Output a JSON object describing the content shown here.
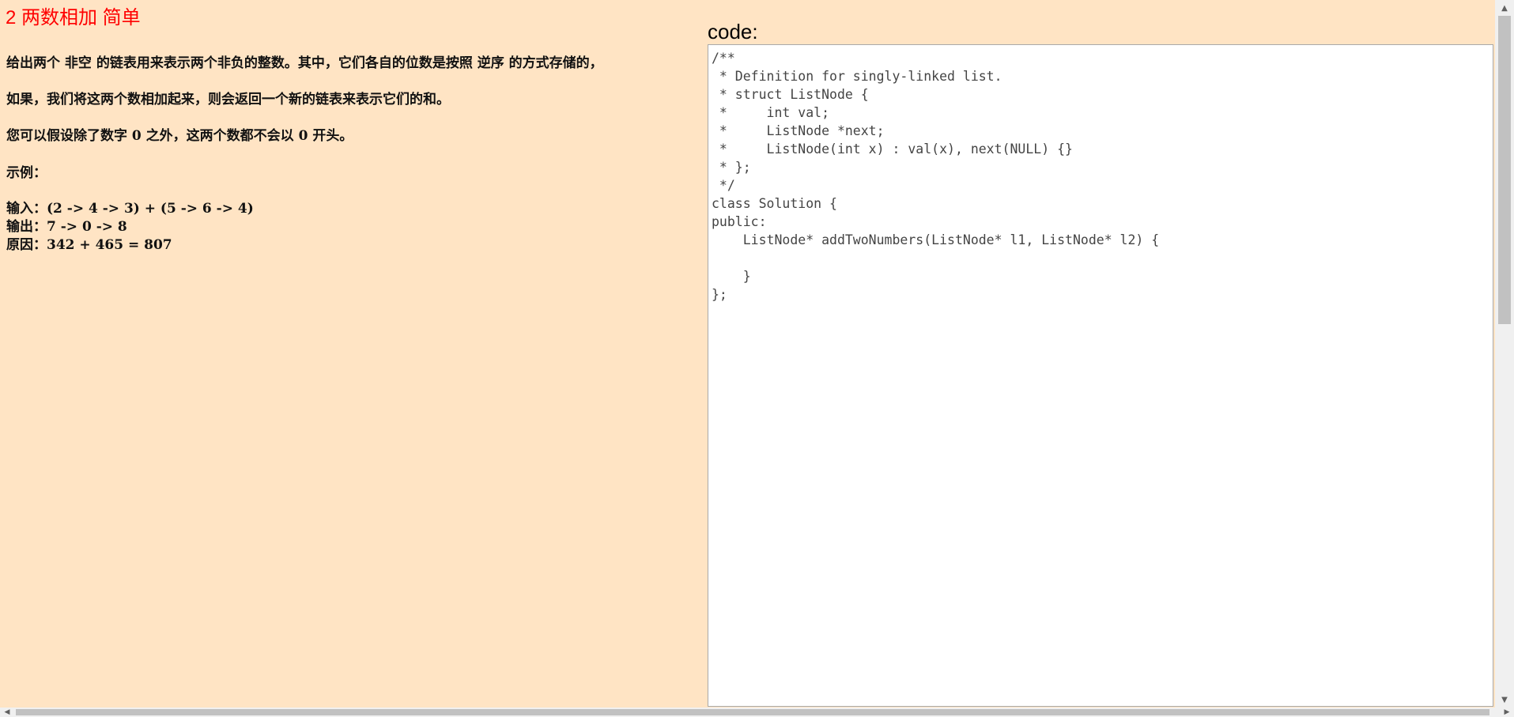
{
  "problem": {
    "title": "2 两数相加 简单",
    "paragraphs": [
      "给出两个 非空 的链表用来表示两个非负的整数。其中，它们各自的位数是按照 逆序 的方式存储的，",
      "如果，我们将这两个数相加起来，则会返回一个新的链表来表示它们的和。",
      "您可以假设除了数字 0 之外，这两个数都不会以 0 开头。",
      "示例："
    ],
    "example": [
      "输入：(2 -> 4 -> 3) + (5 -> 6 -> 4)",
      "输出：7 -> 0 -> 8",
      "原因：342 + 465 = 807"
    ]
  },
  "code": {
    "label": "code:",
    "content": "/**\n * Definition for singly-linked list.\n * struct ListNode {\n *     int val;\n *     ListNode *next;\n *     ListNode(int x) : val(x), next(NULL) {}\n * };\n */\nclass Solution {\npublic:\n    ListNode* addTwoNumbers(ListNode* l1, ListNode* l2) {\n        \n    }\n};"
  },
  "scrollbars": {
    "up_arrow": "▲",
    "down_arrow": "▼",
    "left_arrow": "◀",
    "right_arrow": "▶"
  }
}
